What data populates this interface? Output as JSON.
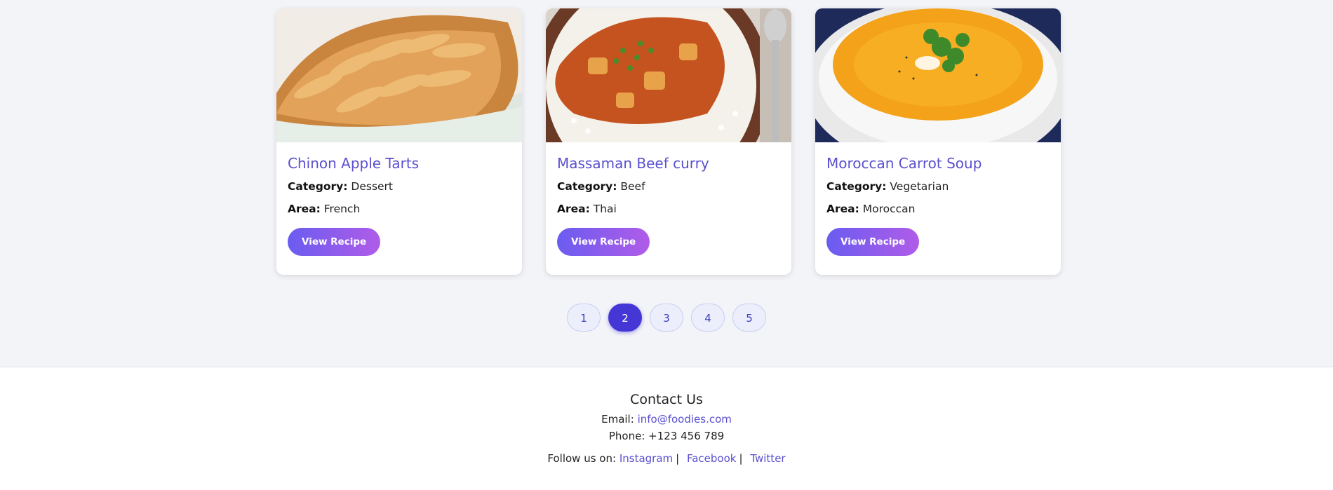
{
  "recipes": [
    {
      "title": "Chinon Apple Tarts",
      "category_label": "Category:",
      "category": "Dessert",
      "area_label": "Area:",
      "area": "French",
      "button": "View Recipe",
      "image": "apple-tart-photo"
    },
    {
      "title": "Massaman Beef curry",
      "category_label": "Category:",
      "category": "Beef",
      "area_label": "Area:",
      "area": "Thai",
      "button": "View Recipe",
      "image": "beef-curry-photo"
    },
    {
      "title": "Moroccan Carrot Soup",
      "category_label": "Category:",
      "category": "Vegetarian",
      "area_label": "Area:",
      "area": "Moroccan",
      "button": "View Recipe",
      "image": "carrot-soup-photo"
    }
  ],
  "pagination": {
    "pages": [
      "1",
      "2",
      "3",
      "4",
      "5"
    ],
    "active": "2"
  },
  "footer": {
    "heading": "Contact Us",
    "email_label": "Email:",
    "email": "info@foodies.com",
    "phone_label": "Phone:",
    "phone": "+123 456 789",
    "follow_label": "Follow us on:",
    "socials": [
      "Instagram",
      "Facebook",
      "Twitter"
    ]
  },
  "colors": {
    "accent": "#5a4fcf",
    "active_page": "#4537d6"
  }
}
